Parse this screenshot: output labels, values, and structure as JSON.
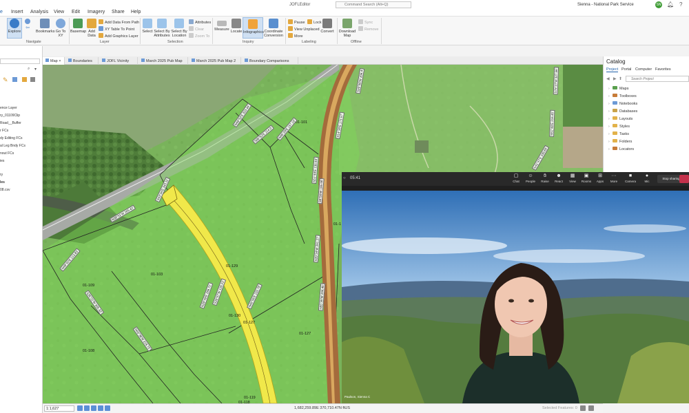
{
  "titlebar": {
    "menu": [
      "Insert",
      "Analysis",
      "View",
      "Edit",
      "Imagery",
      "Share",
      "Help"
    ],
    "project_title": "JOFLEditor",
    "search_placeholder": "Command Search (Alt+Q)",
    "user": "Sienna - National Park Service",
    "user_initials": "SN"
  },
  "ribbon": {
    "navigate": {
      "explore": "Explore",
      "bookmarks": "Bookmarks",
      "goto": "Go To XY",
      "label": "Navigate"
    },
    "layer": {
      "basemap": "Basemap",
      "add_data": "Add Data",
      "add_data_from_path": "Add Data From Path",
      "xy_table": "XY Table To Point",
      "add_graphics": "Add Graphics Layer",
      "label": "Layer"
    },
    "selection": {
      "select": "Select",
      "by_attributes": "Select By Attributes",
      "by_location": "Select By Location",
      "attributes": "Attributes",
      "clear": "Clear",
      "zoom_to": "Zoom To",
      "label": "Selection"
    },
    "inquiry": {
      "measure": "Measure",
      "locate": "Locate",
      "infographics": "Infographics",
      "coord_conv": "Coordinate Conversion",
      "label": "Inquiry"
    },
    "labeling": {
      "pause": "Pause",
      "lock": "Lock",
      "view_unplaced": "View Unplaced",
      "more": "More",
      "convert": "Convert",
      "label": "Labeling"
    },
    "offline": {
      "download": "Download Map",
      "sync": "Sync",
      "remove": "Remove",
      "label": "Offline"
    }
  },
  "left_panel": {
    "items": [
      "ence Layer",
      "ry_01109Clip",
      "Road__Buffer",
      "r FCs",
      "dy Editing FCs",
      "al Leg Bndy FCs",
      "nout FCs",
      "ies",
      "ry",
      "les",
      "08.csv"
    ]
  },
  "map_tabs": [
    "Map",
    "Boundaries",
    "JOFL Vicinity",
    "March 2025 Pub Map",
    "March 2025 Pub Map 2",
    "Boundary Comparisons"
  ],
  "map": {
    "parcels": [
      "01-101",
      "01-103",
      "01-109",
      "01-108",
      "01-129",
      "01-130",
      "01-127",
      "01-127",
      "01-119",
      "01-118",
      "01-1"
    ],
    "bearings": [
      "N46°52'E 323.44'",
      "S86°53'E 214.0'",
      "N45°29'E 157.19'",
      "S29°06'W 208.4'",
      "S14°30'E 173.57'",
      "N51°44'E 136.94'",
      "S8°50'W 186.96'",
      "S20°34'W 201.27'",
      "N29°49'E 269.71'",
      "S28°07'W 126.23'",
      "N46°06'E 233.78'",
      "N49°50'E 213.83'",
      "N38°51'W 265.42'",
      "S43°34'E 343.11'",
      "S35°31'W 305.33'",
      "N43°38'W 219.72'",
      "N55°35'W 284.46'",
      "S75°27'W 327.56'",
      "S51°48'E 216.45'",
      "N41°47'E 339.69'"
    ]
  },
  "status": {
    "scale": "1:1,627",
    "coords": "1,682,259.89E 370,710.47N ftUS",
    "selected": "Selected Features: 0"
  },
  "catalog": {
    "title": "Catalog",
    "tabs": [
      "Project",
      "Portal",
      "Computer",
      "Favorites"
    ],
    "search_placeholder": "Search Project",
    "items": [
      "Maps",
      "Toolboxes",
      "Notebooks",
      "Databases",
      "Layouts",
      "Styles",
      "Tasks",
      "Folders",
      "Locators"
    ]
  },
  "video": {
    "time": "05:41",
    "controls": [
      "Chat",
      "People",
      "Raise",
      "React",
      "View",
      "Rooms",
      "Apps",
      "More",
      "Camera",
      "Mic",
      "Stop sharing"
    ],
    "participant": "Paulson, Sienna C"
  }
}
